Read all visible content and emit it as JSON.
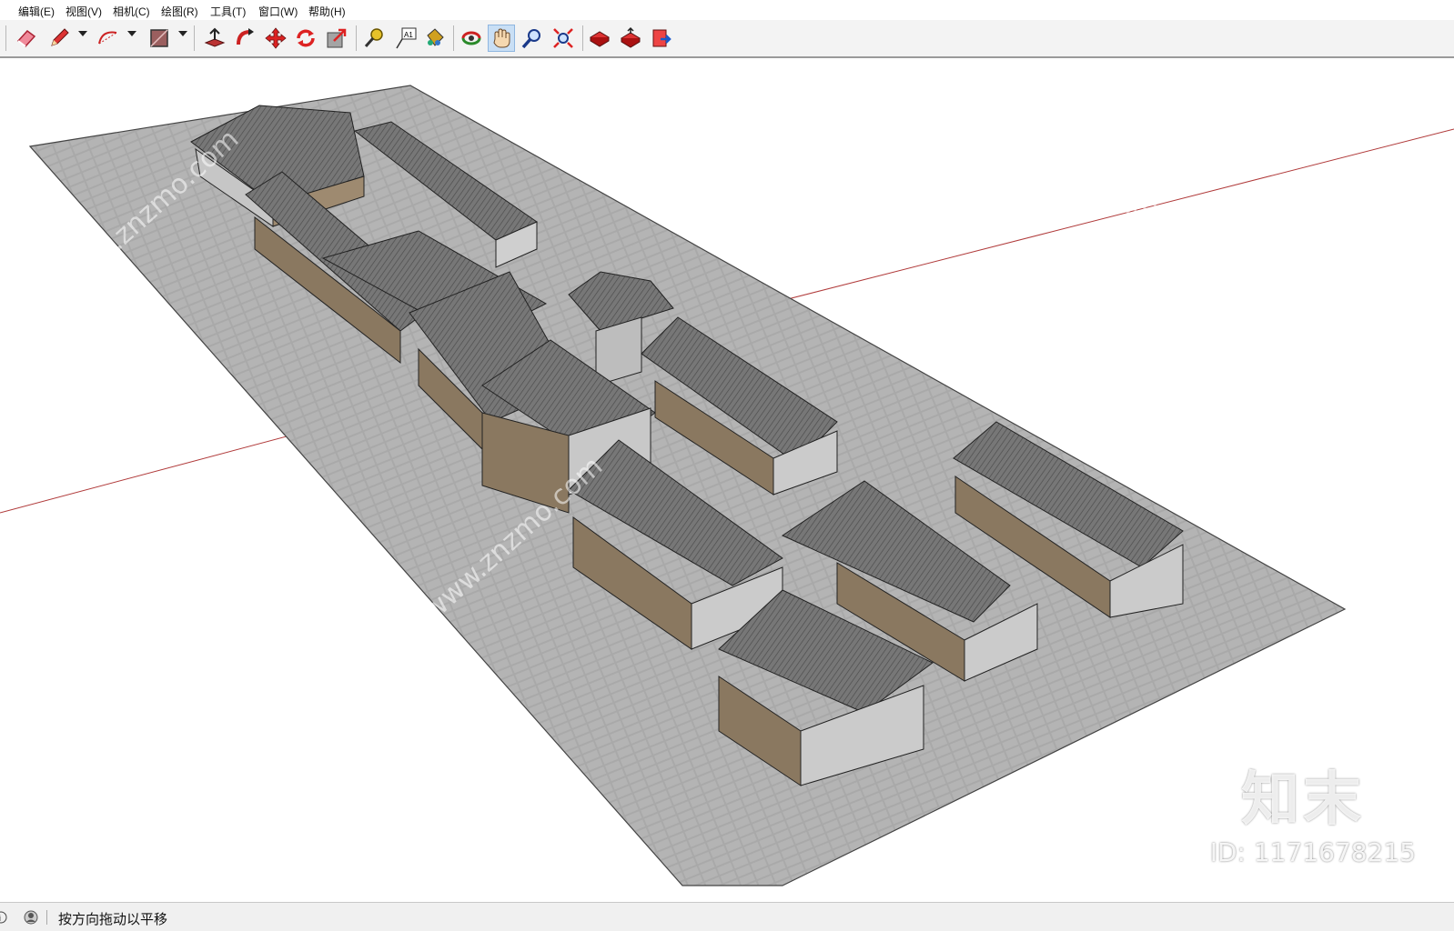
{
  "menu": {
    "items": [
      {
        "label": "编辑(E)"
      },
      {
        "label": "视图(V)"
      },
      {
        "label": "相机(C)"
      },
      {
        "label": "绘图(R)"
      },
      {
        "label": "工具(T)"
      },
      {
        "label": "窗口(W)"
      },
      {
        "label": "帮助(H)"
      }
    ]
  },
  "toolbar": {
    "tools": [
      {
        "icon": "eraser-icon"
      },
      {
        "icon": "pencil-icon"
      },
      {
        "icon": "arc-icon"
      },
      {
        "icon": "rectangle-icon"
      },
      {
        "icon": "push-pull-icon"
      },
      {
        "icon": "follow-me-icon"
      },
      {
        "icon": "move-icon"
      },
      {
        "icon": "rotate-icon"
      },
      {
        "icon": "scale-icon"
      },
      {
        "icon": "tape-measure-icon"
      },
      {
        "icon": "text-icon",
        "text": "A1"
      },
      {
        "icon": "paint-bucket-icon"
      },
      {
        "icon": "orbit-icon"
      },
      {
        "icon": "pan-icon",
        "active": true
      },
      {
        "icon": "zoom-icon"
      },
      {
        "icon": "zoom-extents-icon"
      },
      {
        "icon": "warehouse-icon"
      },
      {
        "icon": "share-model-icon"
      },
      {
        "icon": "extension-warehouse-icon"
      }
    ]
  },
  "status": {
    "message": "按方向拖动以平移"
  },
  "watermark": {
    "logo": "知末",
    "id": "ID: 1171678215",
    "repeat_text": "知末网www.znzmo.com"
  },
  "colors": {
    "ground": "#a9a9a9",
    "roof": "#6f6f6f",
    "wall": "#c8c8c8",
    "axis_red": "#c04040",
    "active_tool": "#c9dff5"
  }
}
